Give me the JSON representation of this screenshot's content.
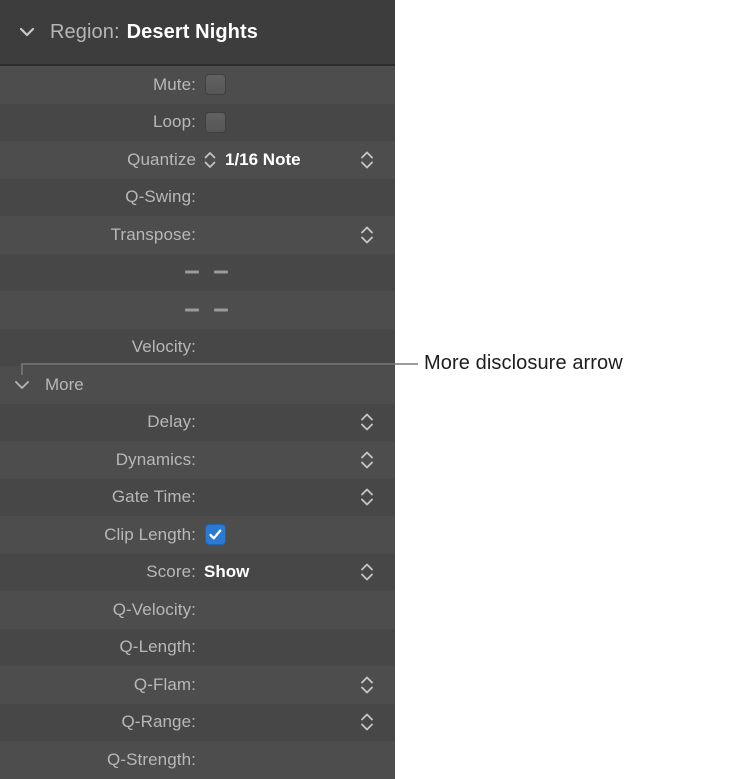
{
  "header": {
    "disclosure_icon": "chevron-down-icon",
    "label": "Region:",
    "value": "Desert Nights"
  },
  "rows": [
    {
      "label": "Mute:",
      "control": "checkbox",
      "checked": false
    },
    {
      "label": "Loop:",
      "control": "checkbox",
      "checked": false
    },
    {
      "label": "Quantize",
      "control": "menu",
      "value": "1/16 Note",
      "inline_stepper": true,
      "stepper": true
    },
    {
      "label": "Q-Swing:",
      "control": "none"
    },
    {
      "label": "Transpose:",
      "control": "stepper",
      "stepper": true
    },
    {
      "label": "",
      "control": "dashes",
      "value": "- -"
    },
    {
      "label": "",
      "control": "dashes",
      "value": "- -"
    },
    {
      "label": "Velocity:",
      "control": "none"
    }
  ],
  "more": {
    "disclosure_icon": "chevron-down-icon",
    "label": "More"
  },
  "more_rows": [
    {
      "label": "Delay:",
      "control": "stepper",
      "stepper": true
    },
    {
      "label": "Dynamics:",
      "control": "stepper",
      "stepper": true
    },
    {
      "label": "Gate Time:",
      "control": "stepper",
      "stepper": true
    },
    {
      "label": "Clip Length:",
      "control": "checkbox",
      "checked": true
    },
    {
      "label": "Score:",
      "control": "menu",
      "value": "Show",
      "stepper": true
    },
    {
      "label": "Q-Velocity:",
      "control": "none"
    },
    {
      "label": "Q-Length:",
      "control": "none"
    },
    {
      "label": "Q-Flam:",
      "control": "stepper",
      "stepper": true
    },
    {
      "label": "Q-Range:",
      "control": "stepper",
      "stepper": true
    },
    {
      "label": "Q-Strength:",
      "control": "none"
    }
  ],
  "callout": {
    "text": "More disclosure arrow",
    "line_color": "#7a7a7a"
  },
  "colors": {
    "panel_bg": "#4b4b4b",
    "header_bg": "#3d3d3d",
    "row_odd": "#4d4d4d",
    "row_even": "#474747",
    "label": "#b8b8b8",
    "value": "#ffffff",
    "checkbox_on": "#2a7ad4",
    "callout_text": "#1d1d1d"
  }
}
